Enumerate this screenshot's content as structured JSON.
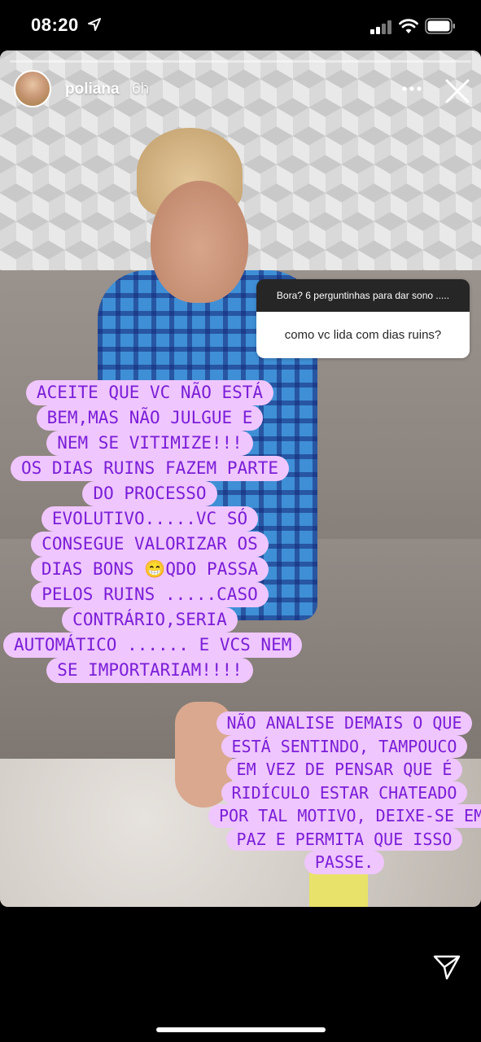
{
  "status_bar": {
    "time": "08:20"
  },
  "story": {
    "username": "poliana",
    "time_ago": "6h",
    "question": {
      "title": "Bora? 6 perguntinhas para dar sono .....",
      "answer": "como vc lida com dias ruins?"
    },
    "caption_a": [
      "ACEITE QUE VC NÃO ESTÁ",
      "BEM,MAS NÃO JULGUE E",
      "NEM SE VITIMIZE!!!",
      "OS DIAS RUINS FAZEM PARTE",
      "DO PROCESSO",
      "EVOLUTIVO.....VC SÓ",
      "CONSEGUE VALORIZAR OS",
      "DIAS BONS 😁QDO PASSA",
      "PELOS RUINS .....CASO",
      "CONTRÁRIO,SERIA",
      "AUTOMÁTICO ...... E VCS NEM",
      "SE IMPORTARIAM!!!!"
    ],
    "caption_b": [
      "NÃO ANALISE DEMAIS O QUE",
      "ESTÁ SENTINDO, TAMPOUCO",
      "EM VEZ DE PENSAR QUE É",
      "RIDÍCULO ESTAR CHATEADO",
      "POR TAL MOTIVO, DEIXE-SE EM",
      "PAZ E PERMITA QUE ISSO",
      "PASSE."
    ]
  },
  "colors": {
    "caption_text": "#7a1ed6",
    "caption_bg": "#f0c6ff"
  },
  "icons": [
    "location-arrow-icon",
    "signal-icon",
    "wifi-icon",
    "battery-icon",
    "more-icon",
    "close-icon",
    "send-icon"
  ]
}
